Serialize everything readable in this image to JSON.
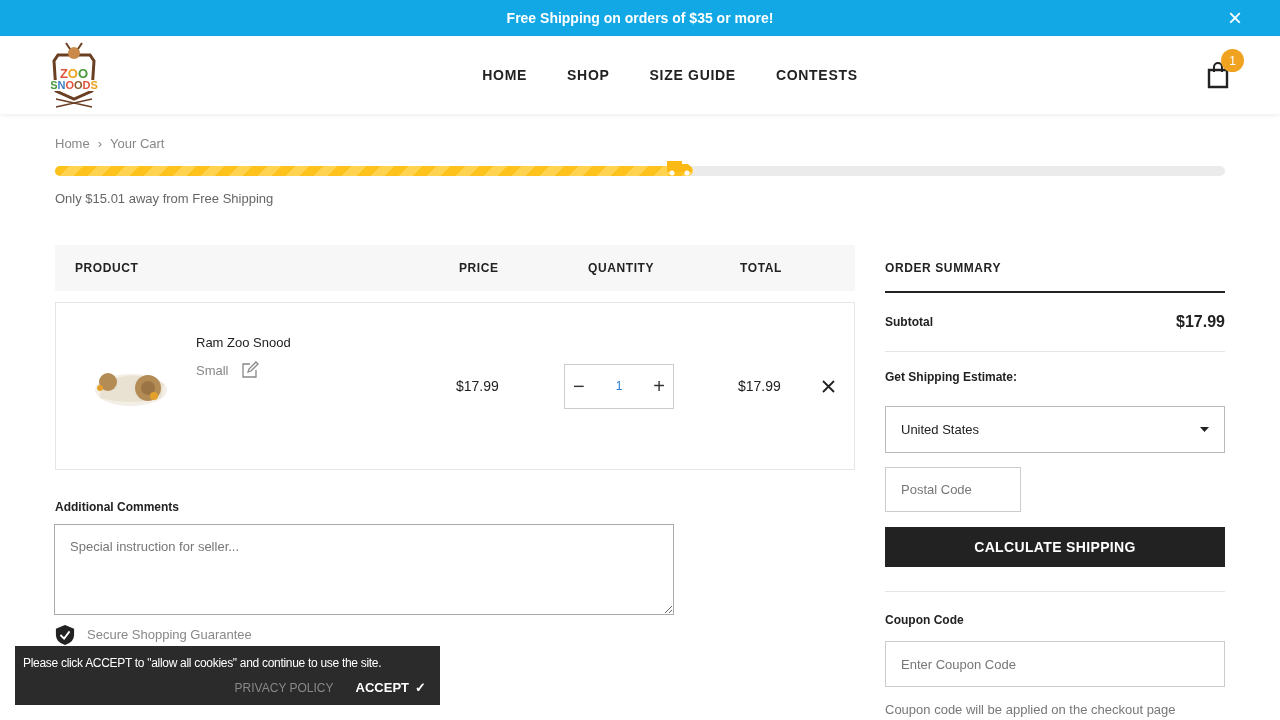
{
  "announcement": {
    "text": "Free Shipping on orders of $35 or more!",
    "close": "×"
  },
  "logo": {
    "top": "ZOO",
    "bottom": "SNOODS"
  },
  "nav": [
    {
      "label": "HOME"
    },
    {
      "label": "SHOP"
    },
    {
      "label": "SIZE GUIDE"
    },
    {
      "label": "CONTESTS"
    }
  ],
  "cart_count": "1",
  "breadcrumb": [
    {
      "label": "Home"
    },
    {
      "label": "Your Cart"
    }
  ],
  "breadcrumb_separator": "›",
  "quantity_controls": {
    "decrease": "−",
    "increase": "+"
  },
  "shipping_progress": {
    "level": 0.545,
    "message": "Only $15.01 away from Free Shipping"
  },
  "table": {
    "columns": [
      "PRODUCT",
      "PRICE",
      "QUANTITY",
      "TOTAL"
    ],
    "rows": [
      {
        "name": "Ram Zoo Snood",
        "variant": "Small",
        "price": "$17.99",
        "quantity": "1",
        "total": "$17.99"
      }
    ]
  },
  "comments": {
    "label": "Additional Comments",
    "placeholder": "Special instruction for seller..."
  },
  "secure": "Secure Shopping Guarantee",
  "summary": {
    "title": "ORDER SUMMARY",
    "subtotal_label": "Subtotal",
    "subtotal": "$17.99",
    "shipping_label": "Get Shipping Estimate:",
    "country": "United States",
    "postal_placeholder": "Postal Code",
    "calculate": "CALCULATE SHIPPING",
    "coupon_label": "Coupon Code",
    "coupon_placeholder": "Enter Coupon Code",
    "coupon_note": "Coupon code will be applied on the checkout page"
  },
  "cookie": {
    "text": "Please click ACCEPT to \"allow all cookies\" and continue to use the site.",
    "privacy": "PRIVACY POLICY",
    "accept": "ACCEPT",
    "accept_mark": "✓"
  }
}
